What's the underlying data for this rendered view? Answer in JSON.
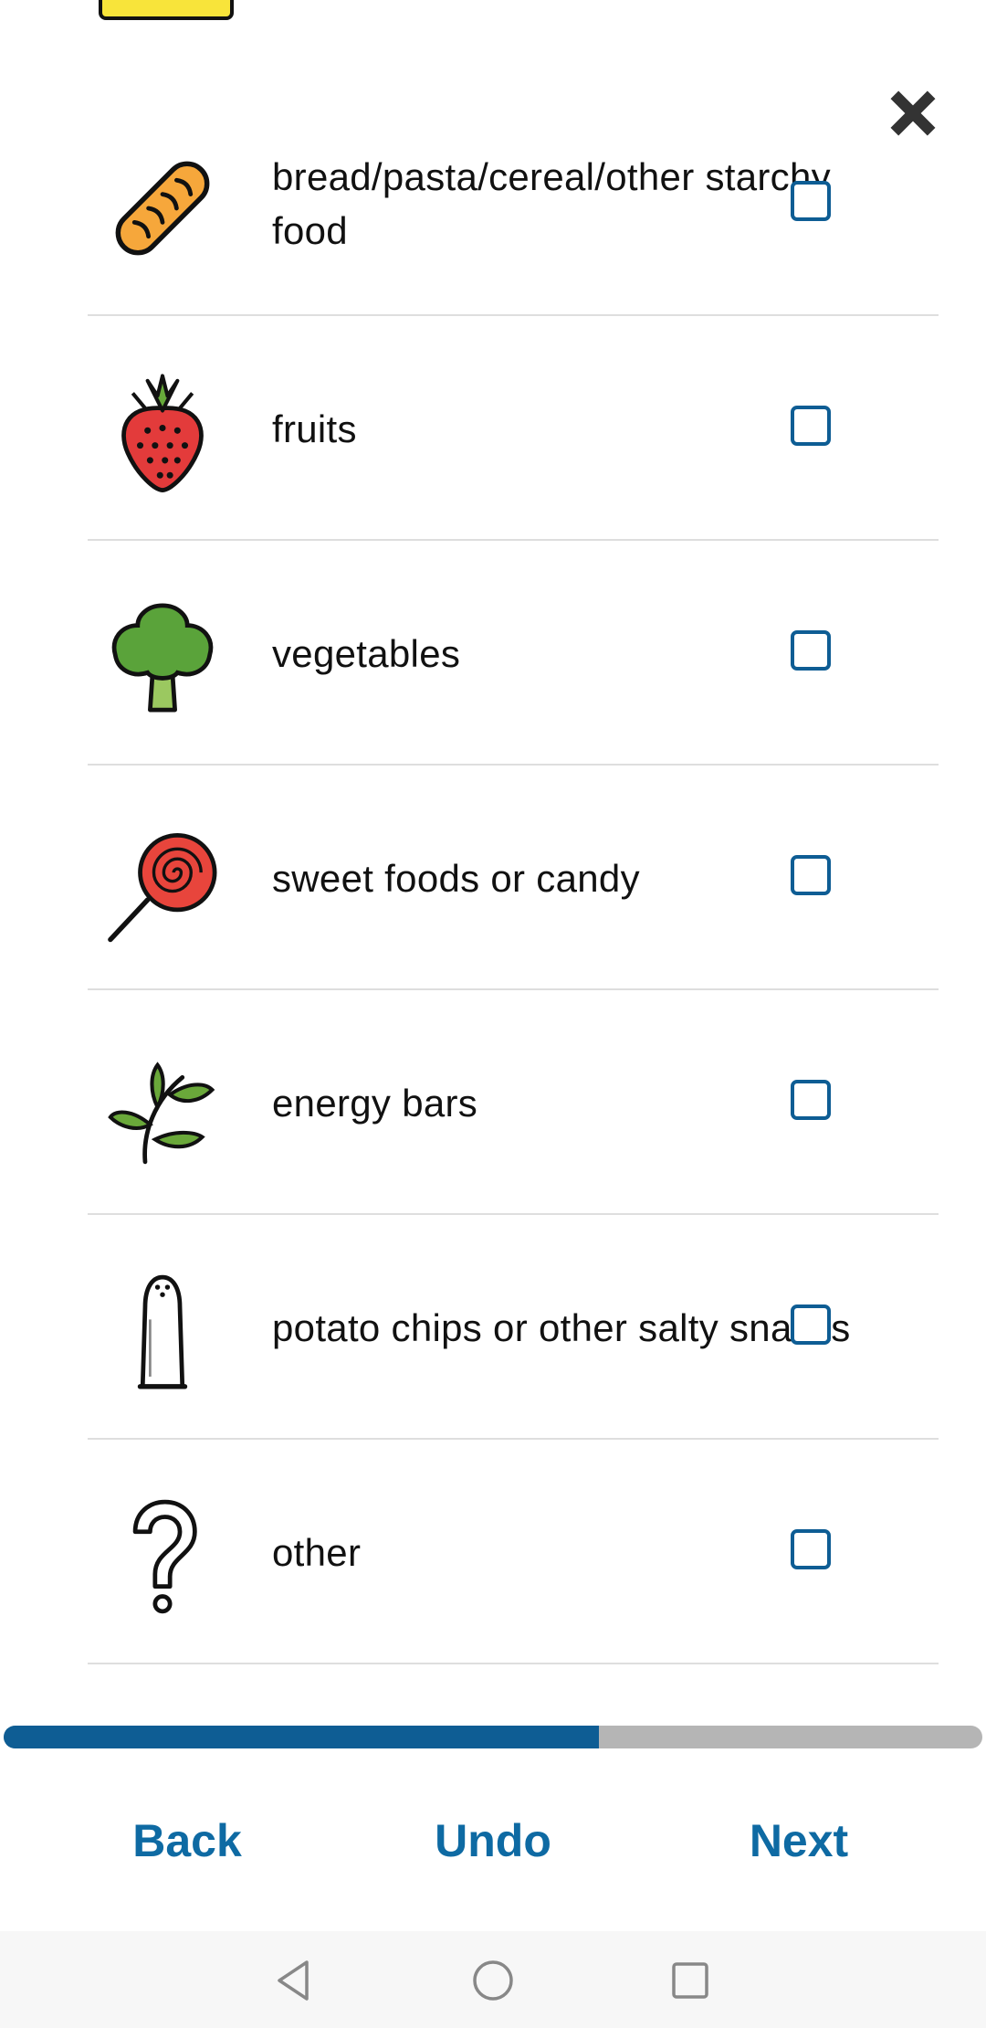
{
  "items": [
    {
      "label": "bread/pasta/cereal/other starchy food",
      "icon": "bread-icon",
      "checked": false
    },
    {
      "label": "fruits",
      "icon": "strawberry-icon",
      "checked": false
    },
    {
      "label": "vegetables",
      "icon": "broccoli-icon",
      "checked": false
    },
    {
      "label": "sweet foods or candy",
      "icon": "lollipop-icon",
      "checked": false
    },
    {
      "label": "energy bars",
      "icon": "leaf-sprig-icon",
      "checked": false
    },
    {
      "label": "potato chips or other salty snacks",
      "icon": "salt-shaker-icon",
      "checked": false
    },
    {
      "label": "other",
      "icon": "question-mark-icon",
      "checked": false
    }
  ],
  "close_icon": "close-icon",
  "progress": {
    "fraction": 0.608
  },
  "nav": {
    "back": "Back",
    "undo": "Undo",
    "next": "Next"
  },
  "colors": {
    "accent": "#0e5d94",
    "button_text": "#0e6aa3",
    "progress_track": "#b5b5b5",
    "checkbox_border": "#0e5d94"
  },
  "system_nav": [
    "back-triangle-icon",
    "home-circle-icon",
    "recents-square-icon"
  ]
}
